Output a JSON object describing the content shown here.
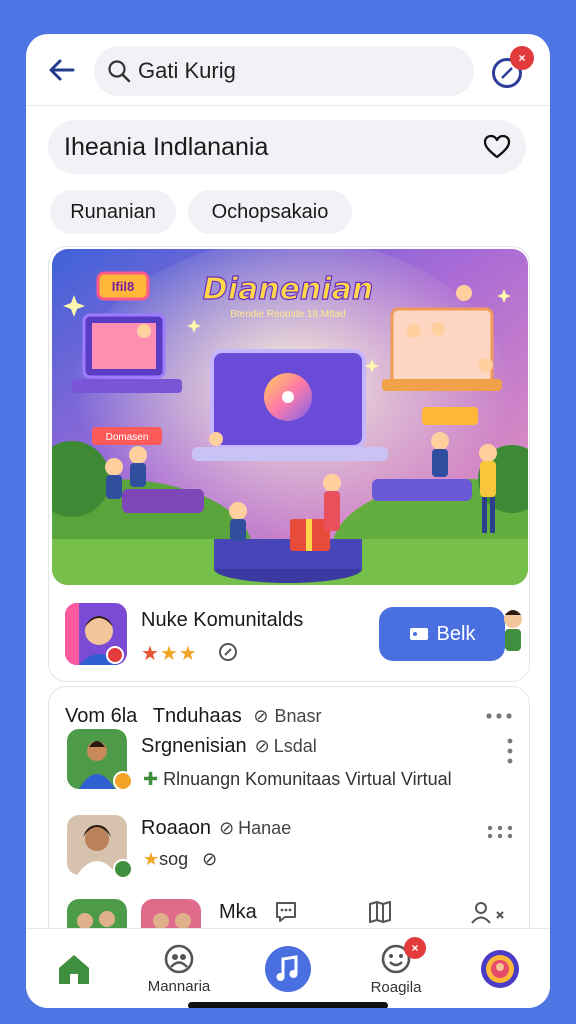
{
  "header": {
    "search_value": "Gati Kurig",
    "notification_badge": "×"
  },
  "title_bar": {
    "title": "Iheania Indlanania"
  },
  "chips": [
    {
      "label": "Runanian"
    },
    {
      "label": "Ochopsakaio"
    }
  ],
  "hero": {
    "banner_title": "Dianenian",
    "banner_subtitle": "Btendie Reomite 18 Mttad",
    "sign_left": "Ifil8",
    "sign_mid": "Domasen",
    "creator_name": "Nuke Komunitalds",
    "rating_stars": 3,
    "join_label": "Belk"
  },
  "list": {
    "header_left": "Vom 6la",
    "header_title": "Tnduhaas",
    "header_meta": "Bnasr",
    "items": [
      {
        "title": "Srgnenisian",
        "meta": "Lsdal",
        "description": "Rlnuangn Komunitaas Virtual Virtual"
      },
      {
        "title": "Roaaon",
        "meta": "Hanae",
        "stars_text": "sog"
      },
      {
        "title": "Mka"
      }
    ]
  },
  "bottom_nav": {
    "items": [
      {
        "label": "",
        "icon": "home-icon"
      },
      {
        "label": "Mannaria",
        "icon": "community-icon"
      },
      {
        "label": "",
        "icon": "music-icon"
      },
      {
        "label": "Roagila",
        "icon": "smiley-icon"
      },
      {
        "label": "",
        "icon": "profile-avatar-icon"
      }
    ],
    "badge": "×"
  },
  "colors": {
    "background": "#4f74e3",
    "accent": "#4a6fe0",
    "home_green": "#3f8f3f",
    "badge_red": "#e23b3b",
    "star": "#f2a427"
  }
}
